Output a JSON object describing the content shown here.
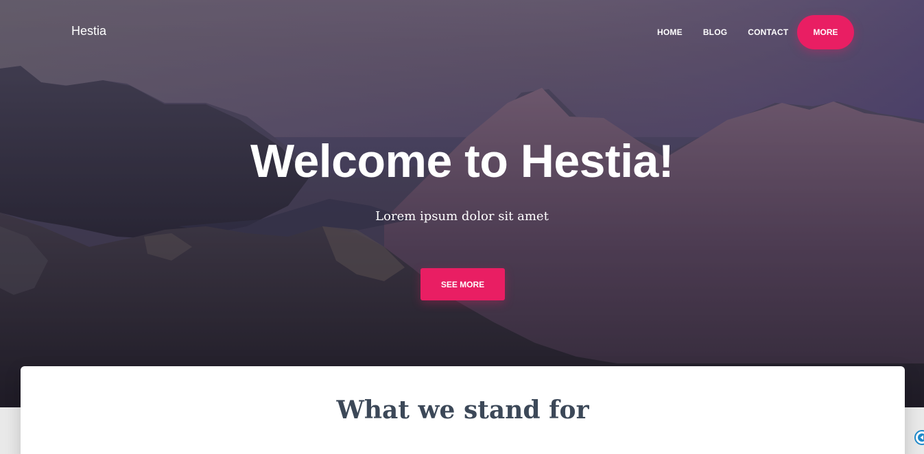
{
  "brand": {
    "name": "Hestia"
  },
  "nav": {
    "links": [
      {
        "label": "HOME"
      },
      {
        "label": "BLOG"
      },
      {
        "label": "CONTACT"
      }
    ],
    "more_label": "MORE"
  },
  "hero": {
    "title": "Welcome to Hestia!",
    "subtitle": "Lorem ipsum dolor sit amet",
    "cta_label": "SEE MORE"
  },
  "section": {
    "title": "What we stand for"
  },
  "colors": {
    "accent": "#e91e63",
    "heading": "#3c4858",
    "text_light": "#ffffff"
  },
  "icons": {
    "corner_widget": "back-arrow-icon"
  }
}
